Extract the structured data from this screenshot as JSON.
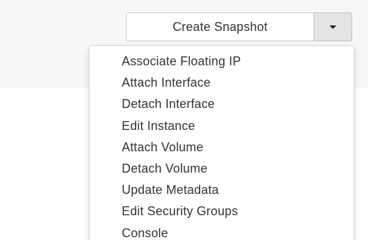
{
  "toolbar": {
    "primary_label": "Create Snapshot",
    "toggle_icon": "caret-down-icon"
  },
  "menu": {
    "items": [
      {
        "label": "Associate Floating IP"
      },
      {
        "label": "Attach Interface"
      },
      {
        "label": "Detach Interface"
      },
      {
        "label": "Edit Instance"
      },
      {
        "label": "Attach Volume"
      },
      {
        "label": "Detach Volume"
      },
      {
        "label": "Update Metadata"
      },
      {
        "label": "Edit Security Groups"
      },
      {
        "label": "Console"
      }
    ]
  },
  "colors": {
    "text": "#333333",
    "border": "#c9c9c9",
    "toggle_bg": "#e4e4e4",
    "page_bg": "#f7f7f7"
  }
}
